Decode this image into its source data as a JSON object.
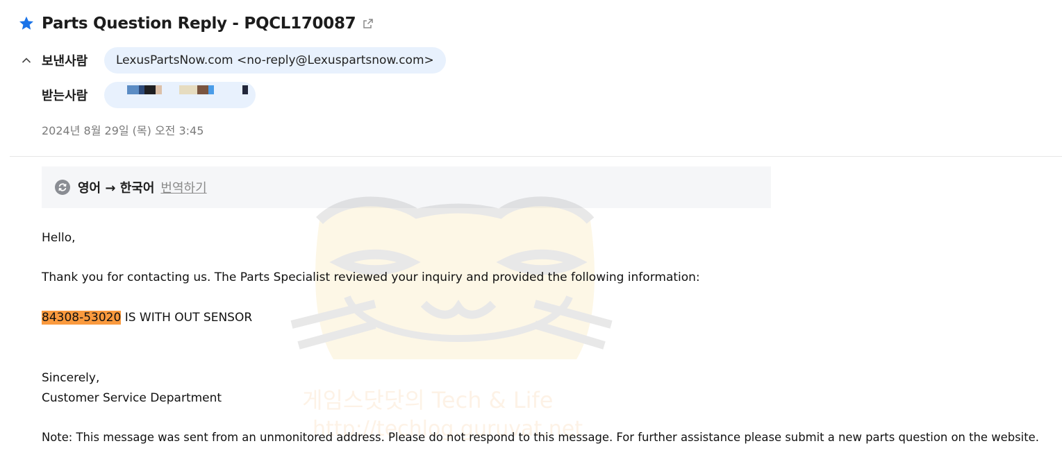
{
  "email": {
    "subject": "Parts Question Reply - PQCL170087",
    "sender_label": "보낸사람",
    "sender": "LexusPartsNow.com <no-reply@Lexuspartsnow.com>",
    "recipient_label": "받는사람",
    "date": "2024년 8월 29일 (목) 오전 3:45"
  },
  "translate": {
    "lang": "영어 → 한국어",
    "action": "번역하기"
  },
  "body": {
    "greeting": "Hello,",
    "intro": "Thank you for contacting us. The Parts Specialist reviewed your inquiry and provided the following information:",
    "part_number": "84308-53020",
    "part_note": " IS WITH OUT SENSOR",
    "closing": "Sincerely,",
    "signature": "Customer Service Department",
    "note": "Note: This message was sent from an unmonitored address. Please do not respond to this message. For further assistance please submit a new parts question on the website."
  },
  "watermark": {
    "line1": "게임스닷닷의 Tech & Life",
    "line2": "http://techlog.guruvat.net"
  },
  "colors": {
    "star": "#1a73e8",
    "chip_bg": "#e8f1fd",
    "highlight": "#fa9a3e",
    "translate_bar_bg": "#f5f6f8"
  }
}
